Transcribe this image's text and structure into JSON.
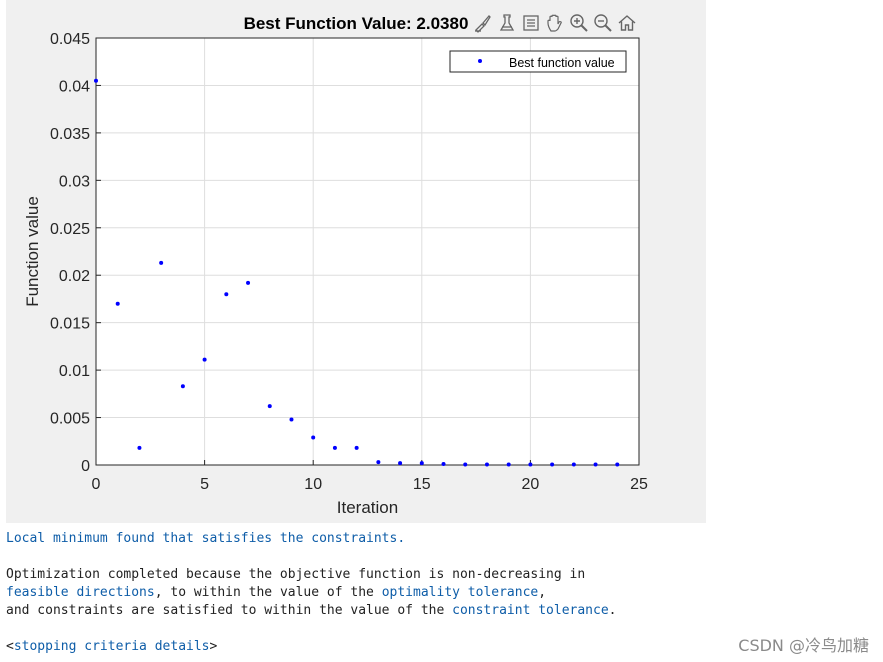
{
  "chart_data": {
    "type": "scatter",
    "title": "Best Function Value: 2.0380",
    "xlabel": "Iteration",
    "ylabel": "Function value",
    "xlim": [
      0,
      25
    ],
    "ylim": [
      0,
      0.045
    ],
    "xticks": [
      "0",
      "5",
      "10",
      "15",
      "20",
      "25"
    ],
    "yticks": [
      "0",
      "0.005",
      "0.01",
      "0.015",
      "0.02",
      "0.025",
      "0.03",
      "0.035",
      "0.04",
      "0.045"
    ],
    "grid": true,
    "legend_position": "top-right",
    "series": [
      {
        "name": "Best function value",
        "color": "#0000ff",
        "x": [
          0,
          1,
          2,
          3,
          4,
          5,
          6,
          7,
          8,
          9,
          10,
          11,
          12,
          13,
          14,
          15,
          16,
          17,
          18,
          19,
          20,
          21,
          22,
          23,
          24
        ],
        "y": [
          0.0405,
          0.017,
          0.0018,
          0.0213,
          0.0083,
          0.0111,
          0.018,
          0.0192,
          0.0062,
          0.0048,
          0.0029,
          0.0018,
          0.0018,
          0.0003,
          0.0002,
          0.0002,
          0.0001,
          5e-05,
          5e-05,
          5e-05,
          5e-05,
          5e-05,
          5e-05,
          5e-05,
          5e-05
        ]
      }
    ]
  },
  "toolbar": {
    "icons": [
      "brush-icon",
      "data-tips-icon",
      "legend-icon",
      "pan-icon",
      "zoom-in-icon",
      "zoom-out-icon",
      "home-icon"
    ]
  },
  "console": {
    "line1": "Local minimum found that satisfies the constraints.",
    "line2a": "Optimization completed because the objective function is non-decreasing in",
    "line3_link1": "feasible directions",
    "line3_text": ", to within the value of the ",
    "line3_link2": "optimality tolerance",
    "line3_end": ",",
    "line4_text": "and constraints are satisfied to within the value of the ",
    "line4_link": "constraint tolerance",
    "line4_end": ".",
    "line5_open": "<",
    "line5_link": "stopping criteria details",
    "line5_close": ">"
  },
  "watermark": "CSDN @冷鸟加糖",
  "colors": {
    "link": "#0e5da8",
    "figure_bg": "#f0f0f0",
    "marker": "#0000ff"
  }
}
